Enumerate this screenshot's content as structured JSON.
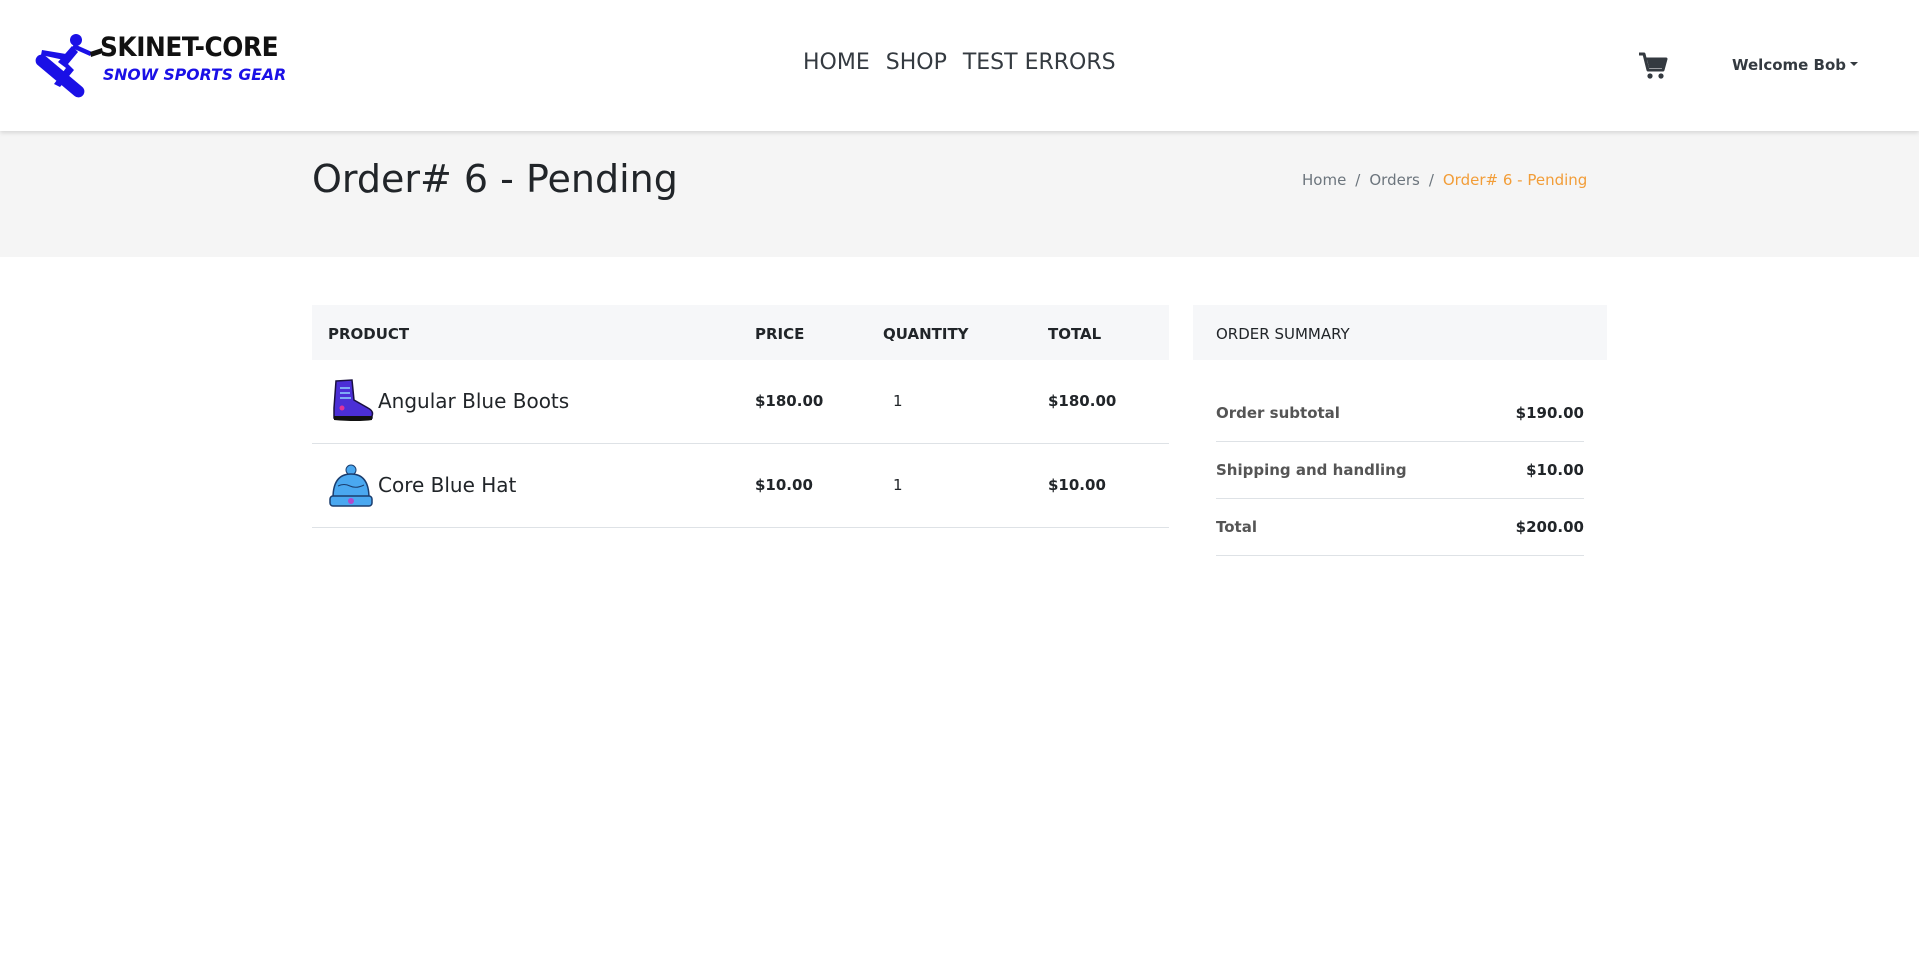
{
  "navbar": {
    "logo": {
      "line1": "SKINET-CORE",
      "line2": "SNOW SPORTS GEAR",
      "brand_color": "#1a10e6"
    },
    "links": [
      "HOME",
      "SHOP",
      "TEST ERRORS"
    ],
    "cart_icon": "shopping-cart-icon",
    "welcome": "Welcome Bob"
  },
  "header": {
    "title": "Order# 6 - Pending",
    "breadcrumb": [
      "Home",
      "Orders",
      "Order# 6 - Pending"
    ],
    "breadcrumb_separator": "/",
    "active_color": "#f29d38"
  },
  "products": {
    "columns": [
      "PRODUCT",
      "PRICE",
      "QUANTITY",
      "TOTAL"
    ],
    "rows": [
      {
        "name": "Angular Blue Boots",
        "image": "boot-image",
        "price": "$180.00",
        "quantity": "1",
        "total": "$180.00"
      },
      {
        "name": "Core Blue Hat",
        "image": "hat-image",
        "price": "$10.00",
        "quantity": "1",
        "total": "$10.00"
      }
    ]
  },
  "summary": {
    "title": "ORDER SUMMARY",
    "rows": [
      {
        "label": "Order subtotal",
        "value": "$190.00"
      },
      {
        "label": "Shipping and handling",
        "value": "$10.00"
      },
      {
        "label": "Total",
        "value": "$200.00"
      }
    ]
  }
}
